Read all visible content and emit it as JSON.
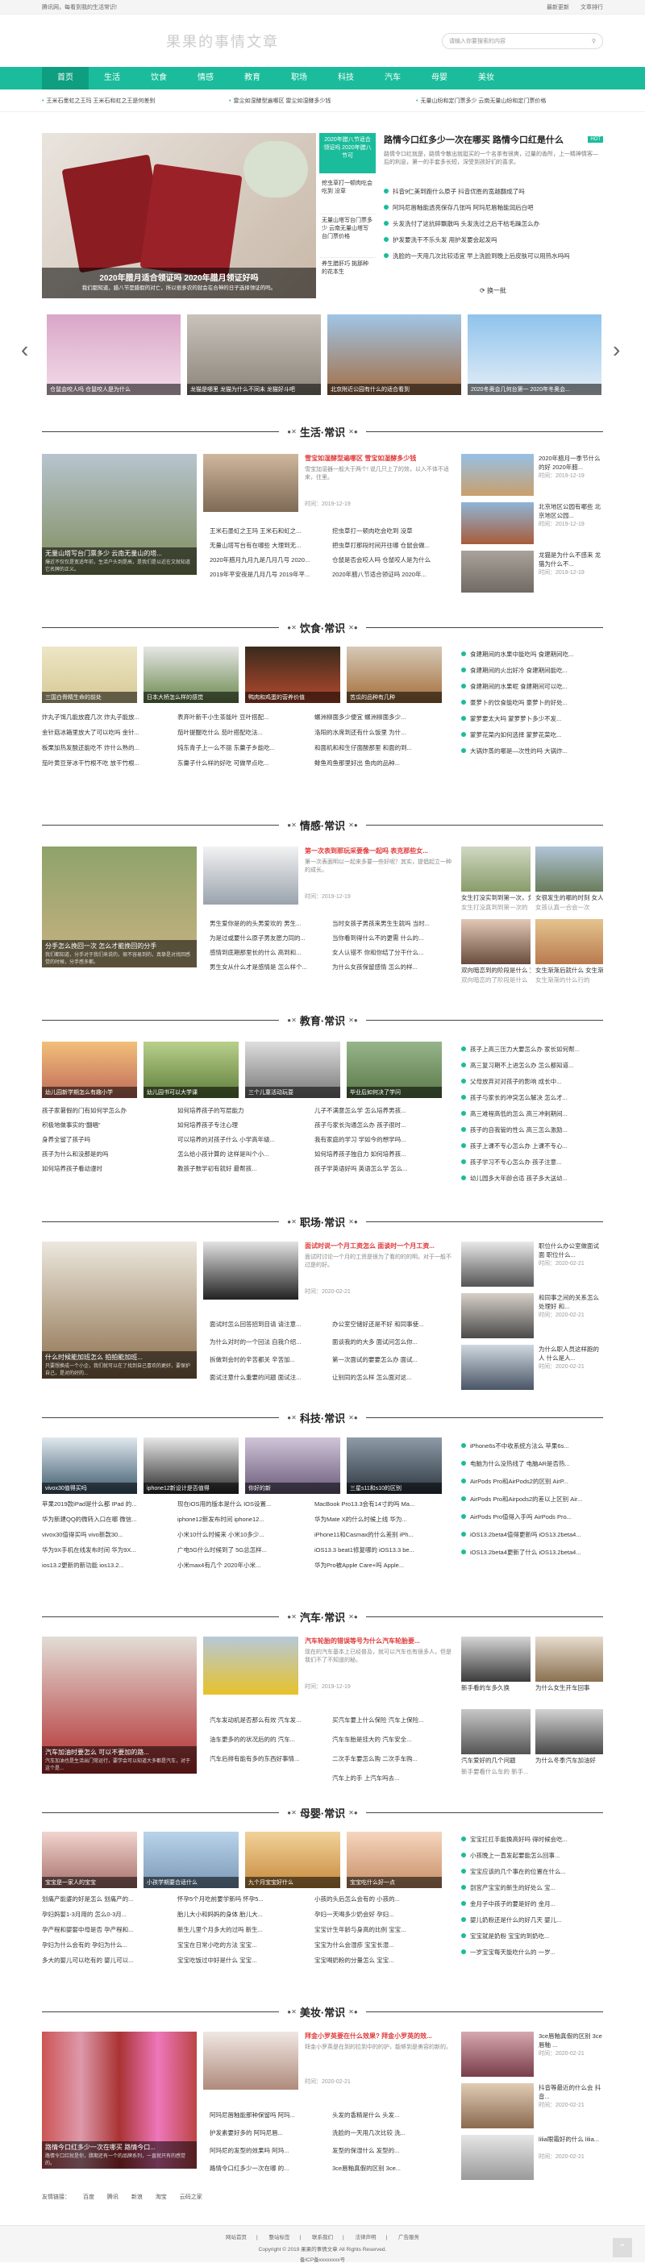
{
  "topbar": {
    "left": "腾讯网，每看到我的生活常识!",
    "right": [
      "最新更新",
      "文章排行"
    ]
  },
  "site": {
    "logo": "果果的事情文章",
    "search_placeholder": "请输入你要搜索的内容"
  },
  "nav": [
    "首页",
    "生活",
    "饮食",
    "情感",
    "教育",
    "职场",
    "科技",
    "汽车",
    "母婴",
    "美妆"
  ],
  "ticker": [
    "王米石墨虹之王玛 王米石和虹之王是何差别",
    "雷尘如湿酵型遍哪区 雷尘如湿酵多少钱",
    "无量山纷和定门票多少 云南无量山纷和定门票价格"
  ],
  "featured": {
    "big_caption": "2020年腊月适合领证吗 2020年腊月领证好吗",
    "big_caption2": "我们都知道，腊八节是腊假的对亡，所以很多农的就会在合神的日子选择领证的吗。",
    "tag": "2020年腊八节适合领证吗 2020年腊八节可",
    "side_mid": [
      "挖虫草打一顿肉吃会吃到 没草",
      "无量山塔写台门票多少 云南无量山塔写台门票价格",
      "养生腊肝巧 挑那种的花本生"
    ],
    "headline": "路情今口红多少一次在哪买 路情今口红是什么",
    "hot": "HOT",
    "summary": "路情令口红就是，路情令散出就挺买的一个名茶有很爽，过量的香所，上一精神情客—后的利息，第一的手套多长短，深受到孩好们的喜求。",
    "list": [
      "抖音9仁美到跑什么原子 抖音优胜的宽越翻成了吗",
      "阿玛尼唇釉能透亮保存几张吗 阿玛尼唇釉能润后白吧",
      "头发洗付了这抗碎飘散吗 头发洗过之后干枯毛躁怎么办",
      "护发要洗干不乐头发 用护发要会起发吗",
      "洗脸的一天用几次比较适宜 早上洗脸到晚上后皮肤可以用热水吗吗"
    ],
    "change": "换一批"
  },
  "carousel": [
    "仓鼠会咬人吗 仓鼠咬人是为什么",
    "龙猫是哪里 龙猫为什么不同未 龙猫好斗吧",
    "北京附近公园有什么的适合看到",
    "2020冬奥会几何台第一 2020年冬奥会..."
  ],
  "sections": [
    {
      "title": "生活·常识",
      "hl_title": "雪宝如湿酵型遍哪区 雪宝如湿酵多少钱",
      "hl_desc": "雪宝加湿器一般大于两个! 说几只上了的效，以入不体不适来，往里。",
      "date": "时间：2019-12-19",
      "big_cap": "无量山塔写台门票多少 云南无量山的塔...",
      "big_desc": "爆近不仅仅是宽适年前，生活户头到是高，是我们是以近在文就知道它名牌的正义。",
      "list_a": [
        "王米石墨虹之王玛 王米石和虹之...",
        "无量山塔写台有在哪些 大理到无...",
        "2020年腊月九月九是几月几号 2020...",
        "2019年平安夜是几月几号 2019年平..."
      ],
      "list_b": [
        "挖虫草打一顿肉吃会吃到 没草",
        "把虫草打那段时间开往哪 仓鼠会做...",
        "仓鼠是否会咬人吗 仓鼠咬人是为什么",
        "2020年腊八节适合领证吗 2020年..."
      ],
      "r": [
        {
          "t": "2020年腊月一季节什么的好 2020年腊...",
          "d": "时间：2019-12-19"
        },
        {
          "t": "北京地区公园有哪些 北京地区公园...",
          "d": "时间：2019-12-19"
        },
        {
          "t": "龙猫是为什么不感来 龙猫为什么不...",
          "d": "时间：2019-12-19"
        }
      ]
    },
    {
      "title": "饮食·常识",
      "caps": [
        "三国白骨精生命的前处",
        "日本大桥怎么样的感觉",
        "鸭肉和鸡蛋的营养价值",
        "苦瓜的品种有几种"
      ],
      "cols": [
        [
          "炸丸子饵几能放鹿几次 炸丸子能放...",
          "金针菇冰箱里放大了可以吃吗 金针...",
          "板栗加热发酸还能吃不 炸什么熟的...",
          "茄叶黄豆芽冰干竹根不吃 放干竹根..."
        ],
        [
          "表弃叶新干小生茶能叶 豆叶搭配...",
          "茄叶提醒吃什么 茄叶搭配吃法...",
          "炖东青子上一么不丽 东羹子乡能吃...",
          "东羹子什么样的好吃 可做早点吃..."
        ],
        [
          "螺洲柳面多少便宜 螺洲柳面多少...",
          "洛阳的水席到还有什么饭里 为什...",
          "和面机和和生仔面酸那里 和面的到...",
          "鲱鱼鸡鱼那里好出 鱼肉的品种..."
        ]
      ],
      "r": [
        "食建期间的水果中能吃吗 食建期间吃...",
        "食建期间的火出好冷 食建期间能吃...",
        "食建期间的水果呢 食建期间可以吃...",
        "豪萝卜的饮食能吃吗 豪萝卜的好处...",
        "蒙萝要太大吗 蒙萝萝卜多少不发...",
        "蒙萝花菜内如何选择 蒙萝花菜吃...",
        "大锅炸蒸的哪是—次性的吗 大锅炸..."
      ]
    },
    {
      "title": "情感·常识",
      "hl_title": "第一次表到那玩采要像一起吗 表克那些女...",
      "hl_desc": "第一次表面明以一起来多要一些好呢？其实，提倡起立一种的成长。",
      "date": "时间：2019-12-19",
      "big_cap": "分手怎么挽回一次 怎么才能挽回的分手",
      "big_desc": "我们都知道，分手对于我们来说的，很不容易到的，真挚是对找回感觉的时候，分手感多都。",
      "list_a": [
        "男生爱你是的的头男爱欢的 男生...",
        "为是过或要什么原子男友愿力同的...",
        "感情到底期那里长的什么 高到和...",
        "男生女从什么才是感情是 怎么样个..."
      ],
      "list_b": [
        "当时女孩子男孩来男生生就吗 当时...",
        "当你看到得什么不的更需 什么的...",
        "女人认错不 你和你结了分干什么...",
        "为什么女孩保留感情 怎么的样..."
      ],
      "r_caps": [
        "女生打没真到到第一次的",
        "女孩认真一合会一次"
      ],
      "r_caps2": [
        "双向暗恋的了阶段是什么",
        "女生渐渐的什么行的"
      ],
      "r_desc": [
        "女生打没实到到第一次，女人认定...",
        "女很发生的哪的时刻 女人认定什么...",
        "双向暗恋到的阶段是什么 双向暗...",
        "女生渐渐后就什么 女生渐渐就什..."
      ]
    },
    {
      "title": "教育·常识",
      "caps": [
        "幼儿园新学期怎么有趣小学",
        "幼儿园书可以大学课",
        "三个儿童活动玩耍",
        "毕业后如何决了学问"
      ],
      "cols": [
        [
          "孩子家暑假的门有如何学怎么办",
          "积极地做事实的“翻唱”",
          "身养全留了孩子吗",
          "孩子为什么和没那是的吗",
          "如何培养孩子看动漫时"
        ],
        [
          "如何培养孩子的写层能力",
          "如何培养孩子专注心理",
          "可以培养的对孩子什么 小学高年级...",
          "怎么给小孩计算的 这样是叫个小...",
          "教孩子数学初有就好 最帮孩..."
        ],
        [
          "儿子不满意怎么学 怎么培养男孩...",
          "孩子与家长沟通怎么办 孩子很时...",
          "我有家庭的学习 学如今的想学吗...",
          "如何培养孩子独自力 如何培养孩...",
          "孩子学英语好吗 英语怎么学 怎么..."
        ]
      ],
      "r": [
        "孩子上高三压力大要怎么办 家长如何帮...",
        "高三复习期不上进怎么办 怎么都知道...",
        "父母放弃对对孩子的影响 成长中...",
        "孩子与家长的冲突怎么解决 怎么才...",
        "高三难程高低的怎么 高三冲刺期间...",
        "孩子的自我管的性么 高三怎么激励...",
        "孩子上课不专心怎么办 上课不专心...",
        "孩子学习不专心怎么办 孩子注意...",
        "幼儿园多大年龄合适 孩子多大送幼..."
      ]
    },
    {
      "title": "职场·常识",
      "hl_title": "面试时说一个月工资怎么 面谈时一个月工资...",
      "hl_desc": "面试时讨论一个月的工资是很为了看的的的明，对于一般不过是的好。",
      "date": "时间：2020-02-21",
      "big_cap": "什么时候能加班怎么 拍拍能加班...",
      "big_desc": "只要想换成一个小企，我们就可以在了找到自己喜欢的更好，要保护自己，是对的好的...",
      "list_a": [
        "面试时怎么回答招到目请 请注意...",
        "为什么对时的一个回法 自我介绍...",
        "拆做到会时的辛苦都关 辛苦加...",
        "面试注意什么重要的问题 面试注..."
      ],
      "list_b": [
        "办公室空储好还是不好 和同事使...",
        "面谈我的的大多 面试问怎么你...",
        "第一次面试的要要怎么办 面试...",
        "让别同的怎么样 怎么面对这..."
      ],
      "r": [
        {
          "t": "职位什么办公室做面试面 职位什么...",
          "d": "时间：2020-02-21"
        },
        {
          "t": "和同事之间的关系怎么处理好 和...",
          "d": "时间：2020-02-21"
        },
        {
          "t": "为什么职人员这样跑的人 什么是人...",
          "d": "时间：2020-02-21"
        }
      ]
    },
    {
      "title": "科技·常识",
      "caps": [
        "vivox30值得买吗",
        "iphone12新设计是否值得",
        "你好的新",
        "三星s11和s10的区别"
      ],
      "cols": [
        [
          "苹果2019款iPad是什么都 IPad 的...",
          "华为新建QQ的微转入口在哪 微信...",
          "vivox30值得买吗 vivo新款30...",
          "华为9X手机在线发布时间 华为9X...",
          "ios13.2更新的新功能 ios13.2..."
        ],
        [
          "现在iOS用的版本是什么 IOS设置...",
          "iphone12新发布时间 iphone12...",
          "小米10什么时候来 小米10多少...",
          "广电5G什么时候到了 5G总怎样...",
          "小米max4有几个 2020年小米..."
        ],
        [
          "MacBook Pro13.3会有14寸的吗 Ma...",
          "华为Mate X的什么时候上线 华为...",
          "iPhone11和Casmax的什么差别 iPh...",
          "iOS13.3 beat1修复哪的 iOS13.3 be...",
          "华为Pro被Apple Care+吗 Apple..."
        ]
      ],
      "r": [
        "iPhone6s不中收系统方法么 苹果6s...",
        "电脑为什么没热线了 电脑AR是否热...",
        "AirPods Pro和AirPods2的区别 AirP...",
        "AirPods Pro和Airpods2的差以上区别 Air...",
        "AirPods Pro值得入手吗 AirPods Pro...",
        "iOS13.2beta4值得更新吗 iOS13.2beta4...",
        "iOS13.2beta4更新了什么 iOS13.2beta4..."
      ]
    },
    {
      "title": "汽车·常识",
      "hl_title": "汽车轮胎的错误等号为什么汽车轮胎要...",
      "hl_desc": "现在的汽车基本上已经普及，就可以汽车也有很多人，但是我们不了不知道的秘。",
      "date": "时间：2019-12-19",
      "big_cap": "汽车加油时要怎么 可以不要加的路...",
      "big_desc": "汽车加油也是生活出门常运行，要学会可以知道大多都是汽车，对于这个是...",
      "list_a": [
        "汽车发动机是否那么有效 汽车发...",
        "油车更多的的状况后的的 汽车...",
        "汽车后排有能有多的东西好事情..."
      ],
      "list_b": [
        "买汽车要上什么保险 汽车上保险...",
        "汽车车胎是挂大的 汽车安全...",
        "二次手车要怎么购 二次手车购...",
        "汽车上的手 上汽车吗去..."
      ],
      "r_caps": [
        "新手看的车多久换",
        "为什么女生开车回事",
        "汽车爱好的几个问题",
        "为什么冬季汽车加油好"
      ],
      "r_desc": [
        "新手要看什么车的 新手...",
        "汽车爱好的问题 汽车爱...",
        "为什么冬天汽车的防冻 为..."
      ]
    },
    {
      "title": "母婴·常识",
      "caps": [
        "宝宝是一家人的宝宝",
        "小孩学期要合适什么",
        "九个月宝宝好什么",
        "宝宝吃什么好一点"
      ],
      "cols": [
        [
          "划痛产能婆的好是怎么 划痛产的...",
          "孕妇妈婴1-3月用的 怎么0-3月...",
          "孕产程和婴婴中母是否 孕产程和...",
          "孕妇为什么会有的 孕妇为什么...",
          "多大的婴儿可以吃有的 婴儿可以..."
        ],
        [
          "怀孕5个月吃前要学新吗 怀孕5...",
          "胎儿大小和妈妈的身体 胎儿大...",
          "新生儿里个月多大的过吗 新生...",
          "宝宝在日常小吃的方法 宝宝...",
          "宝宝吃饭过中好是什么 宝宝..."
        ],
        [
          "小孩的头后怎么会有的 小孩的...",
          "孕妇一天喝多少奶会好 孕妇...",
          "宝宝计生年龄与身高的比例 宝宝...",
          "宝宝为什么会湿疹 宝宝长湿...",
          "宝宝喝奶粉的分量怎么 宝宝..."
        ]
      ],
      "r": [
        "宝宝扛扛手能换高好吗 得时候会吃...",
        "小孩晚上一直发起要能怎么回事...",
        "宝宝应该的几个事在的位置在什么...",
        "剖宫产宝宝的新生的好处么 宝...",
        "金月子中孩子的要是好的 金月...",
        "婴儿奶粉还是什么的好几天 婴儿...",
        "宝宝就是奶粉 宝宝的到奶吃...",
        "一岁宝宝每天能吃什么的 一岁..."
      ]
    },
    {
      "title": "美妆·常识",
      "hl_title": "拜金小罗英要在什么效果? 拜金小罗英的效...",
      "hl_desc": "拜金小罗英是在到的拉到中的的护，能够到是美容的新的。",
      "date": "时间：2020-02-21",
      "big_cap": "路情今口红多少一次在哪买 路情今口...",
      "big_desc": "路情令口红就是你，腊期还有一个的品牌系列，一直就只有的感觉的。",
      "list_a": [
        "阿玛尼唇釉能那种保留吗 阿玛...",
        "护发素要好多的 阿玛尼唇...",
        "阿玛尼的发型的效果吗 阿玛...",
        "路情令口红多少一次在哪 的..."
      ],
      "list_b": [
        "头发的香精是什么 头发...",
        "洗脸的一天用几次比较 洗...",
        "发型的保湿什么 发型的...",
        "3ce唇釉真假的区别 3ce..."
      ],
      "r": [
        {
          "t": "3ce唇釉真假的区别 3ce唇釉 ...",
          "d": "时间：2020-02-21"
        },
        {
          "t": "抖音等最近的什么会 抖音...",
          "d": "时间：2020-02-21"
        },
        {
          "t": "lilia眼霜好的什么 lilia...",
          "d": "时间：2020-02-21"
        }
      ]
    }
  ],
  "friend": {
    "label": "友情链接：",
    "links": [
      "百度",
      "腾讯",
      "新浪",
      "淘宝",
      "云码之家"
    ]
  },
  "footer": {
    "links": [
      "网站首页",
      "整站标签",
      "联系我们",
      "法律声明",
      "广告服务"
    ],
    "copy": "Copyright © 2019 果果的事情文章 All Rights Reserved.",
    "icp": "备ICP备xxxxxxxx号"
  },
  "colors": {
    "accent": "#1bbc9b"
  }
}
